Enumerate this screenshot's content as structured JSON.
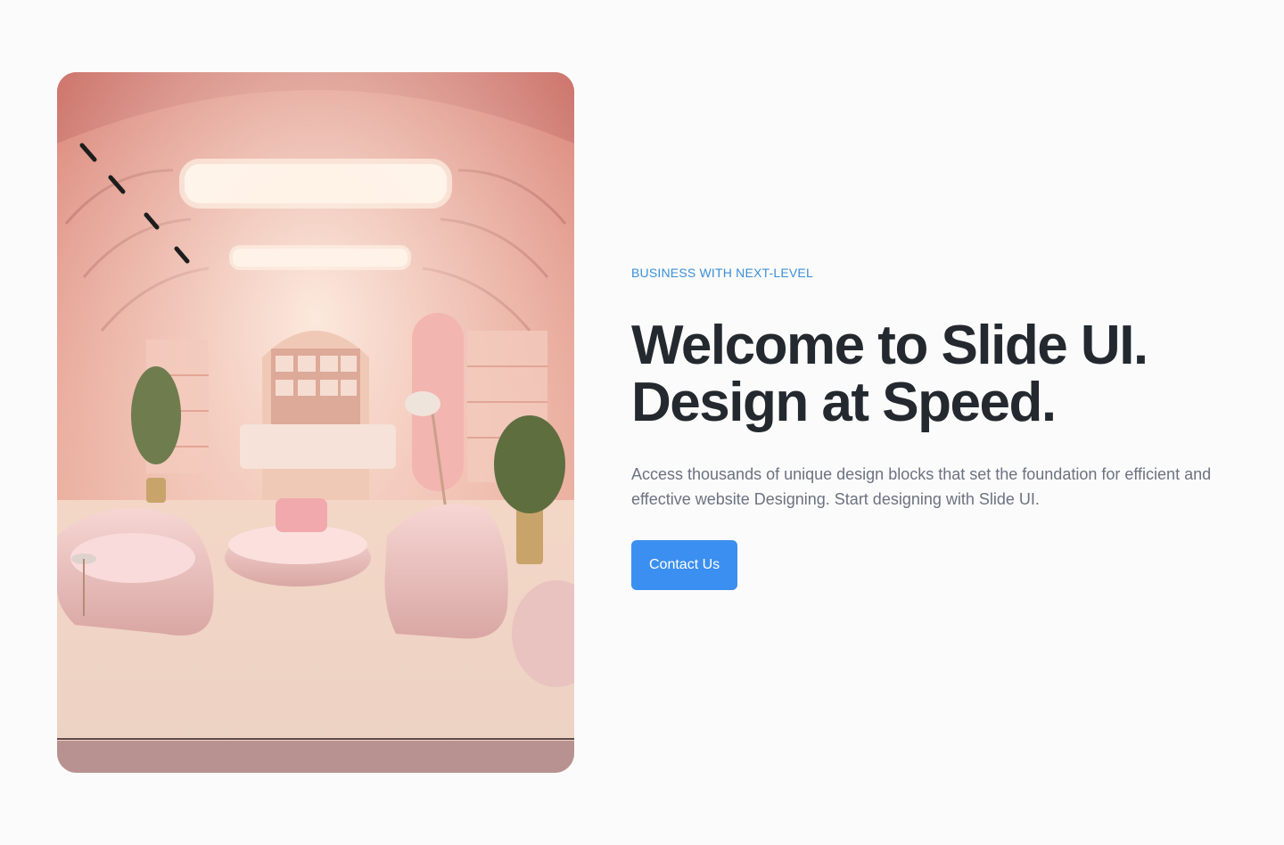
{
  "hero": {
    "eyebrow": "BUSINESS WITH NEXT-LEVEL",
    "headline_line1": "Welcome to Slide UI.",
    "headline_line2": "Design at Speed.",
    "description": "Access thousands of unique design blocks that set the foundation for efficient and effective website Designing. Start designing with Slide UI.",
    "cta_label": "Contact Us",
    "image_alt": "Pink interior lounge with armchairs and shelves"
  },
  "colors": {
    "accent": "#3b8ff0",
    "eyebrow": "#3b8fd6",
    "headline": "#24292f",
    "body_text": "#6b7280",
    "background": "#fbfbfb"
  }
}
